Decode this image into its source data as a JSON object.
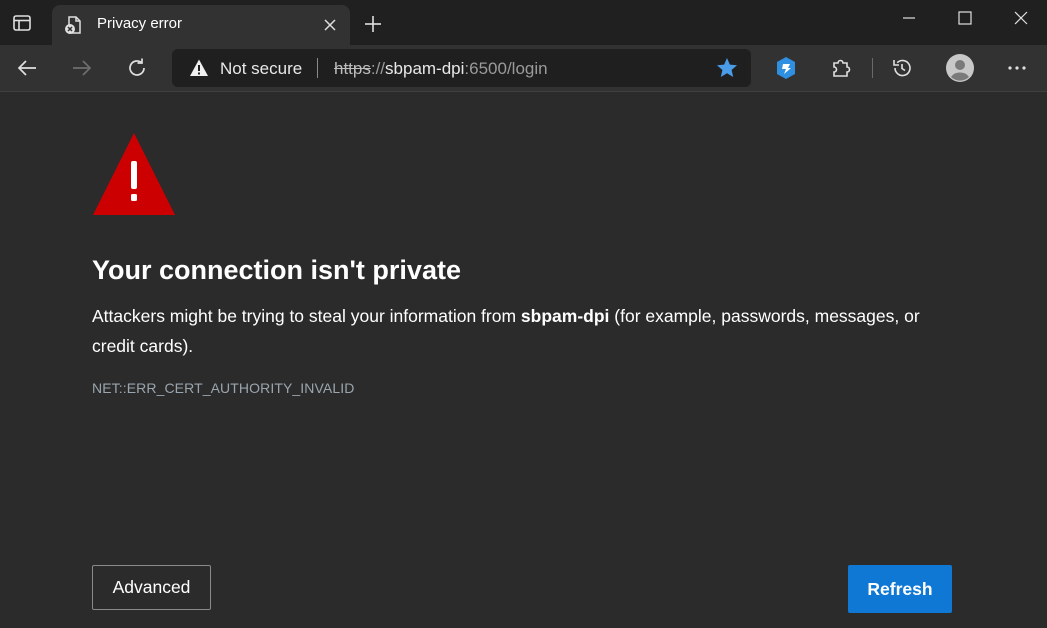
{
  "tab": {
    "title": "Privacy error"
  },
  "addressbar": {
    "security_label": "Not secure",
    "url_scheme": "https",
    "url_separator": "://",
    "url_host": "sbpam-dpi",
    "url_rest": ":6500/login"
  },
  "icons": {
    "tab_actions": "tab-actions-icon",
    "favicon": "error-page-icon",
    "tab_close": "close-icon",
    "new_tab": "plus-icon",
    "back": "back-arrow-icon",
    "forward": "forward-arrow-icon",
    "refresh": "refresh-icon",
    "warning": "warning-triangle-icon",
    "favorite": "star-icon",
    "extension_shield": "extension-shield-icon",
    "extensions": "puzzle-icon",
    "history": "history-icon",
    "profile": "profile-avatar-icon",
    "menu": "more-icon"
  },
  "page": {
    "heading": "Your connection isn't private",
    "desc_before": "Attackers might be trying to steal your information from ",
    "desc_host": "sbpam-dpi",
    "desc_after": " (for example, passwords, messages, or credit cards).",
    "error_code": "NET::ERR_CERT_AUTHORITY_INVALID",
    "advanced_label": "Advanced",
    "refresh_label": "Refresh"
  },
  "colors": {
    "warning_red": "#cc0000",
    "refresh_blue": "#0f78d4",
    "star_blue": "#4a9be8",
    "page_bg": "#2b2b2b"
  }
}
